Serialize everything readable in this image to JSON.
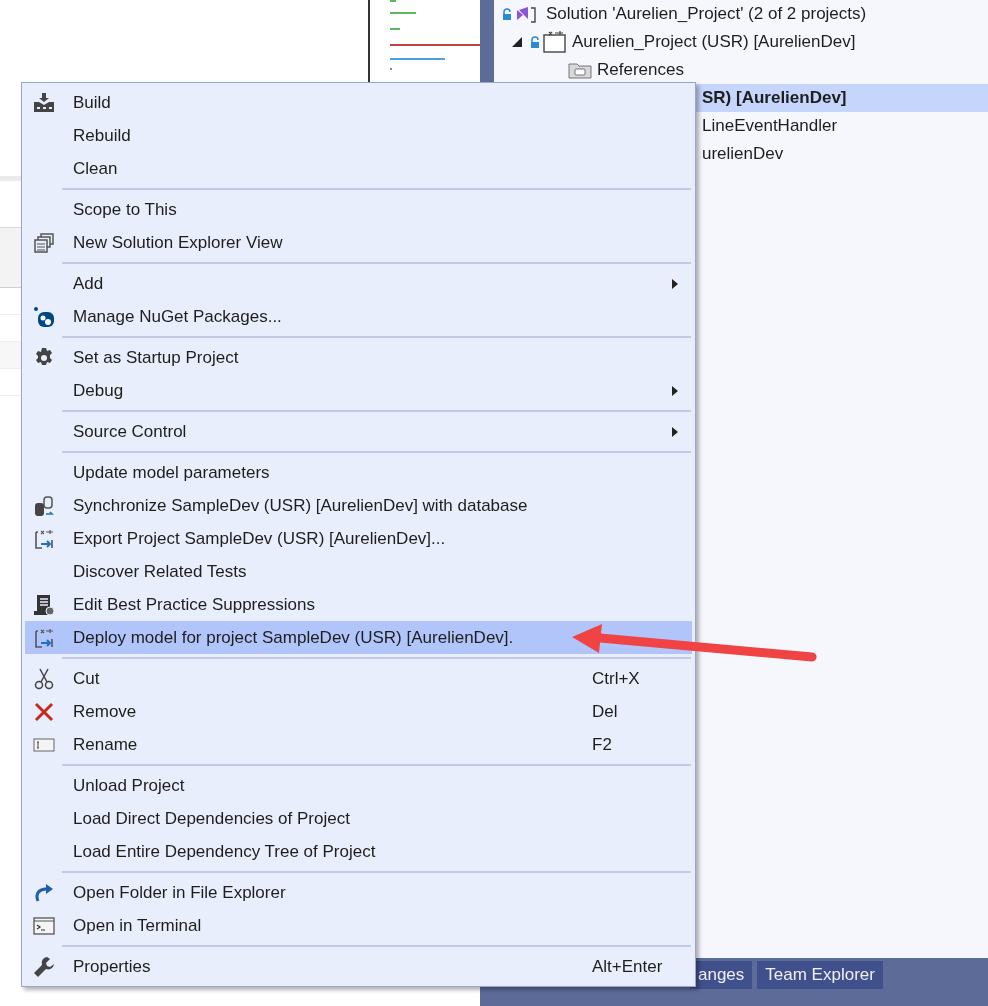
{
  "solution_explorer": {
    "tree": [
      {
        "kind": "solution",
        "label": "Solution 'Aurelien_Project' (2 of 2 projects)",
        "selected": false,
        "startup": false,
        "children": [
          {
            "kind": "project",
            "label": "Aurelien_Project (USR) [AurelienDev]",
            "selected": false,
            "startup": false,
            "expanded": true,
            "children": [
              {
                "kind": "folder",
                "label": "References",
                "selected": false,
                "startup": false
              }
            ]
          },
          {
            "kind": "partial",
            "label": "SR) [AurelienDev]",
            "selected": true,
            "startup": true,
            "children": [
              {
                "kind": "partial",
                "label": "LineEventHandler",
                "selected": false,
                "startup": false
              },
              {
                "kind": "partial",
                "label": "urelienDev",
                "selected": false,
                "startup": false
              }
            ]
          }
        ]
      }
    ]
  },
  "bottom_tabs": [
    {
      "label": "anges",
      "selected": false
    },
    {
      "label": "Team Explorer",
      "selected": false
    }
  ],
  "context_menu": {
    "groups": [
      [
        {
          "label": "Build",
          "kind": "build"
        },
        {
          "label": "Rebuild"
        },
        {
          "label": "Clean"
        }
      ],
      [
        {
          "label": "Scope to This"
        },
        {
          "label": "New Solution Explorer View",
          "kind": "new-view"
        }
      ],
      [
        {
          "label": "Add",
          "submenu": true
        },
        {
          "label": "Manage NuGet Packages...",
          "kind": "nuget"
        }
      ],
      [
        {
          "label": "Set as Startup Project",
          "kind": "gear"
        },
        {
          "label": "Debug",
          "submenu": true
        }
      ],
      [
        {
          "label": "Source Control",
          "submenu": true
        }
      ],
      [
        {
          "label": "Update model parameters"
        },
        {
          "label": "Synchronize SampleDev (USR) [AurelienDev] with database",
          "kind": "sync"
        },
        {
          "label": "Export Project SampleDev (USR) [AurelienDev]...",
          "kind": "export"
        },
        {
          "label": "Discover Related Tests"
        },
        {
          "label": "Edit Best Practice Suppressions",
          "kind": "scroll"
        },
        {
          "label": "Deploy model for project SampleDev (USR) [AurelienDev].",
          "kind": "export",
          "highlighted": true
        }
      ],
      [
        {
          "label": "Cut",
          "kind": "cut",
          "shortcut": "Ctrl+X"
        },
        {
          "label": "Remove",
          "kind": "remove",
          "shortcut": "Del"
        },
        {
          "label": "Rename",
          "kind": "rename",
          "shortcut": "F2"
        }
      ],
      [
        {
          "label": "Unload Project"
        },
        {
          "label": "Load Direct Dependencies of Project"
        },
        {
          "label": "Load Entire Dependency Tree of Project"
        }
      ],
      [
        {
          "label": "Open Folder in File Explorer",
          "kind": "redo"
        },
        {
          "label": "Open in Terminal",
          "kind": "terminal"
        }
      ],
      [
        {
          "label": "Properties",
          "kind": "wrench",
          "shortcut": "Alt+Enter"
        }
      ]
    ]
  }
}
